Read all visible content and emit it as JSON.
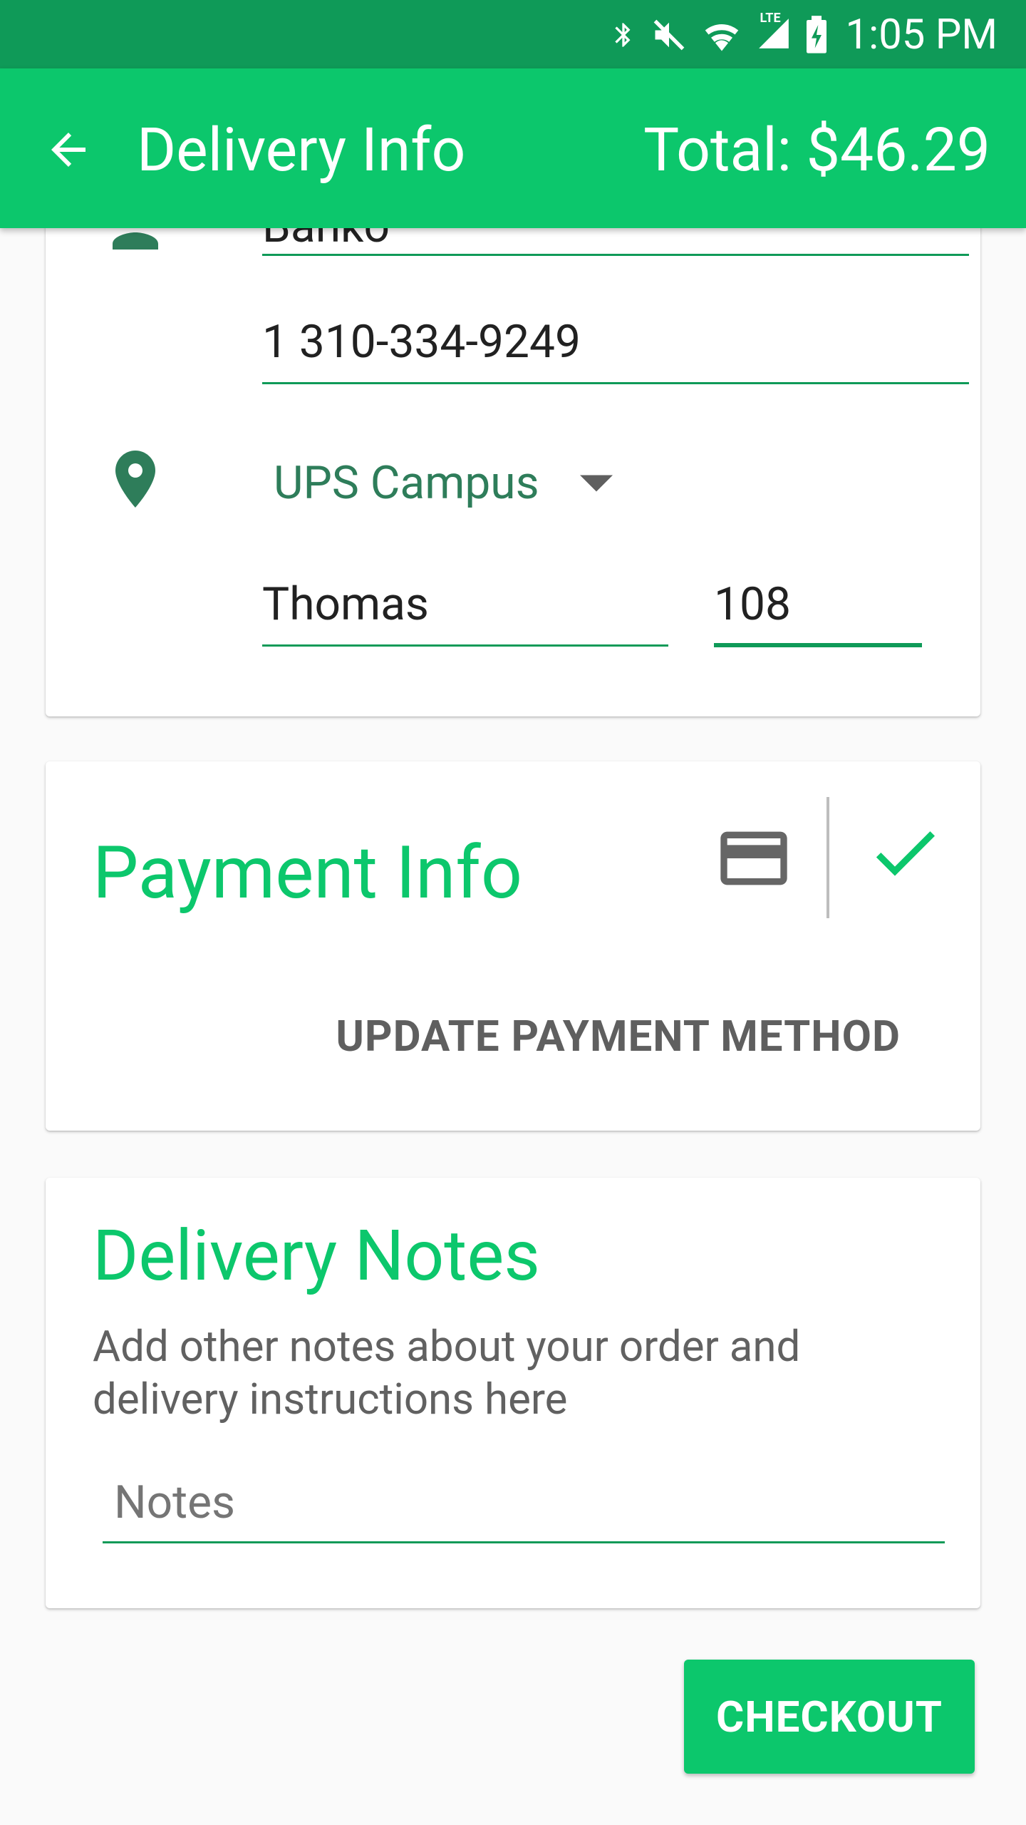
{
  "status_bar": {
    "time": "1:05 PM",
    "network": "LTE"
  },
  "app_bar": {
    "title": "Delivery Info",
    "total": "Total: $46.29"
  },
  "contact": {
    "name_partial": "Banko",
    "phone": "1 310-334-9249",
    "location_selected": "UPS Campus",
    "building": "Thomas",
    "room": "108"
  },
  "payment": {
    "title": "Payment Info",
    "update_label": "UPDATE PAYMENT METHOD"
  },
  "notes": {
    "title": "Delivery Notes",
    "description": "Add other notes about your order and delivery instructions here",
    "placeholder": "Notes"
  },
  "checkout_label": "CHECKOUT",
  "colors": {
    "accent": "#0cc76c",
    "status_bar": "#0f9a58",
    "icon": "#2e7d5a"
  }
}
